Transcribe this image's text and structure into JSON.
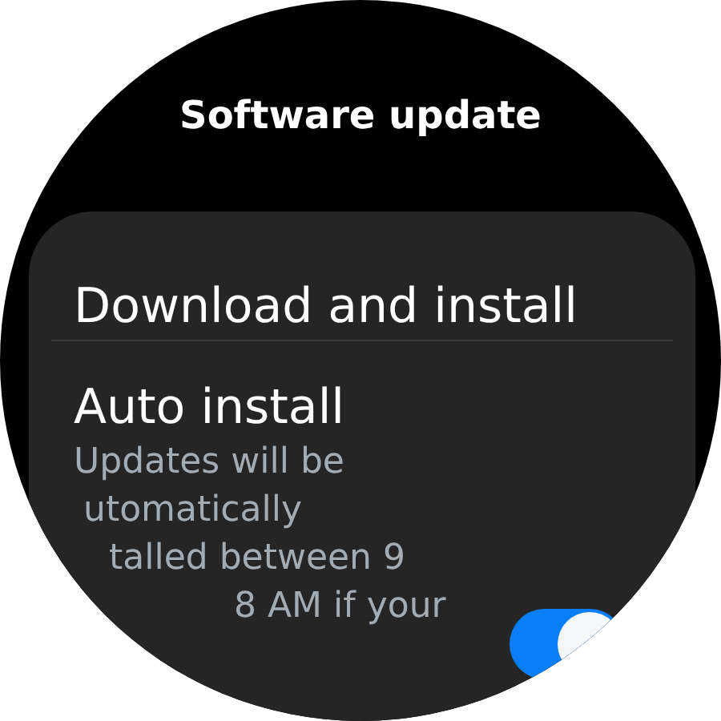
{
  "header": {
    "title": "Software update"
  },
  "items": [
    {
      "kind": "action",
      "label": "Download and install"
    },
    {
      "kind": "toggle",
      "label": "Auto install",
      "description_lines": [
        "Updates will be",
        "utomatically",
        "talled between 9",
        "8 AM if your"
      ],
      "on": true
    }
  ]
}
